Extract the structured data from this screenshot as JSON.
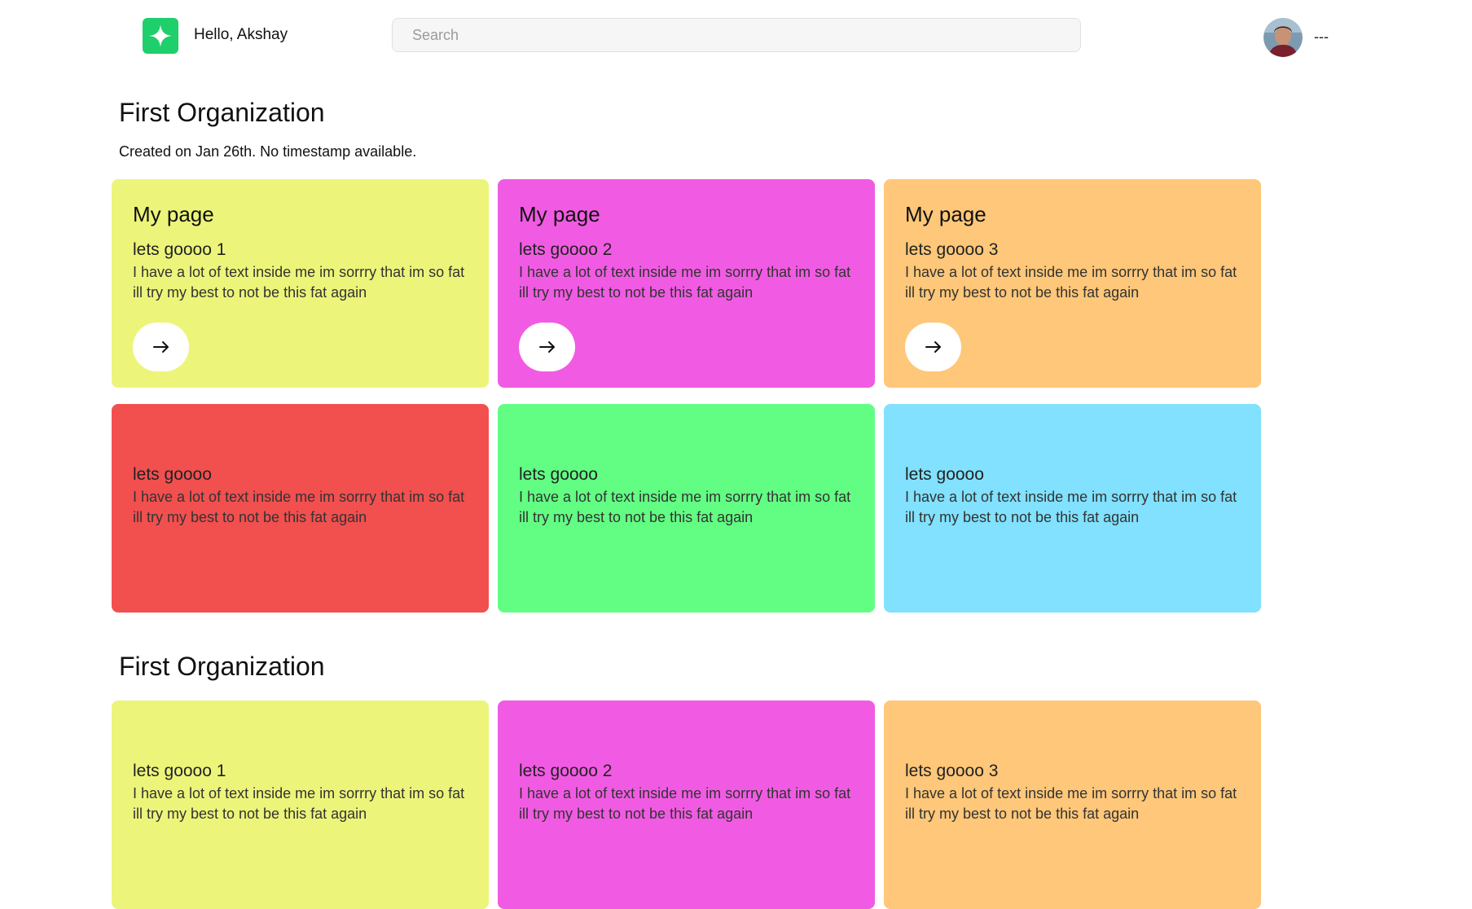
{
  "header": {
    "greeting": "Hello, Akshay",
    "search_placeholder": "Search",
    "user_menu_label": "---"
  },
  "sections": [
    {
      "title": "First Organization",
      "subtitle": "Created on Jan 26th. No timestamp available.",
      "cards": [
        {
          "title": "My page",
          "subtitle": "lets goooo 1",
          "body": "I have a lot of text inside me im sorrry that im so fat ill try my best to not be this fat again",
          "color": "#ecf57a"
        },
        {
          "title": "My page",
          "subtitle": "lets goooo 2",
          "body": "I have a lot of text inside me im sorrry that im so fat ill try my best to not be this fat again",
          "color": "#f15be3"
        },
        {
          "title": "My page",
          "subtitle": "lets goooo 3",
          "body": "I have a lot of text inside me im sorrry that im so fat ill try my best to not be this fat again",
          "color": "#fec779"
        },
        {
          "title": "",
          "subtitle": "lets goooo",
          "body": "I have a lot of text inside me im sorrry that im so fat ill try my best to not be this fat again",
          "color": "#f24f4f"
        },
        {
          "title": "",
          "subtitle": "lets goooo",
          "body": "I have a lot of text inside me im sorrry that im so fat ill try my best to not be this fat again",
          "color": "#62fe83"
        },
        {
          "title": "",
          "subtitle": "lets goooo",
          "body": "I have a lot of text inside me im sorrry that im so fat ill try my best to not be this fat again",
          "color": "#81e1fe"
        }
      ]
    },
    {
      "title": "First Organization",
      "cards": [
        {
          "title": "",
          "subtitle": "lets goooo 1",
          "body": "I have a lot of text inside me im sorrry that im so fat ill try my best to not be this fat again",
          "color": "#ecf57a"
        },
        {
          "title": "",
          "subtitle": "lets goooo 2",
          "body": "I have a lot of text inside me im sorrry that im so fat ill try my best to not be this fat again",
          "color": "#f15be3"
        },
        {
          "title": "",
          "subtitle": "lets goooo 3",
          "body": "I have a lot of text inside me im sorrry that im so fat ill try my best to not be this fat again",
          "color": "#fec779"
        }
      ]
    }
  ],
  "icons": {
    "logo": "sparkle-icon",
    "card_button": "arrow-right-icon"
  },
  "colors": {
    "logo_bg": "#1ecf6b"
  }
}
